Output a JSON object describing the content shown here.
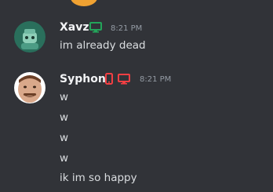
{
  "messages": [
    {
      "author": "Xavz",
      "author_color": "#f2f3f5",
      "badges": [
        "desktop-icon"
      ],
      "badge_color": "#23a55a",
      "timestamp": "8:21 PM",
      "lines": [
        "im already dead"
      ]
    },
    {
      "author": "Syphon",
      "author_color": "#f2f3f5",
      "badges": [
        "mobile-icon",
        "desktop-icon"
      ],
      "badge_color": "#f23f43",
      "timestamp": "8:21 PM",
      "lines": [
        "w",
        "w",
        "w",
        "w",
        "ik im so happy"
      ]
    }
  ]
}
